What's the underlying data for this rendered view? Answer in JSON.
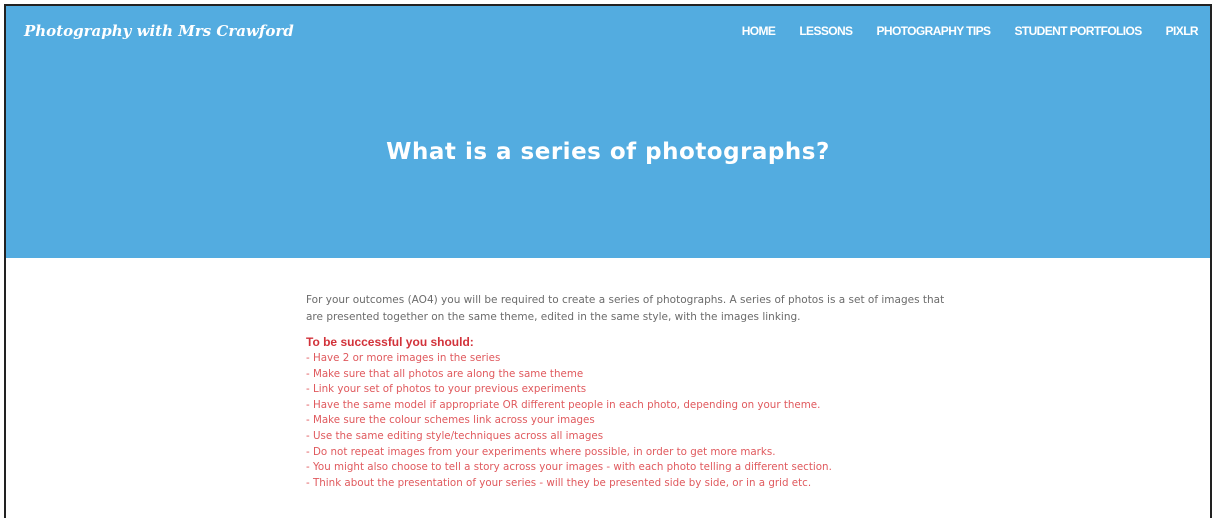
{
  "header": {
    "site_title": "Photography with Mrs Crawford",
    "nav": [
      {
        "label": "HOME"
      },
      {
        "label": "LESSONS"
      },
      {
        "label": "PHOTOGRAPHY TIPS"
      },
      {
        "label": "STUDENT PORTFOLIOS"
      },
      {
        "label": "PIXLR"
      }
    ],
    "background_color": "#53ace0"
  },
  "hero": {
    "title": "What is a series of photographs?"
  },
  "main": {
    "intro": "For your outcomes (AO4) you will be required to create a series of photographs. A series of photos is a set of images that are presented together on the same theme, edited in the same style, with the images linking.",
    "success_heading": "To be successful you should:",
    "criteria": [
      "- Have 2 or more images in the series",
      "- Make sure that all photos are along the same theme",
      "- Link your set of photos to your previous experiments",
      "- Have the same model if appropriate OR different people in each photo, depending on your theme.",
      "- Make sure the colour schemes link across your images",
      "- Use the same editing style/techniques across all images",
      "- Do not repeat images from your experiments where possible, in order to get more marks.",
      "- You might also choose to tell a story across your images - with each photo telling a different section.",
      "- Think about the presentation of your series - will they be presented side by side, or in a grid etc."
    ],
    "accent_color": "#d2323a"
  }
}
